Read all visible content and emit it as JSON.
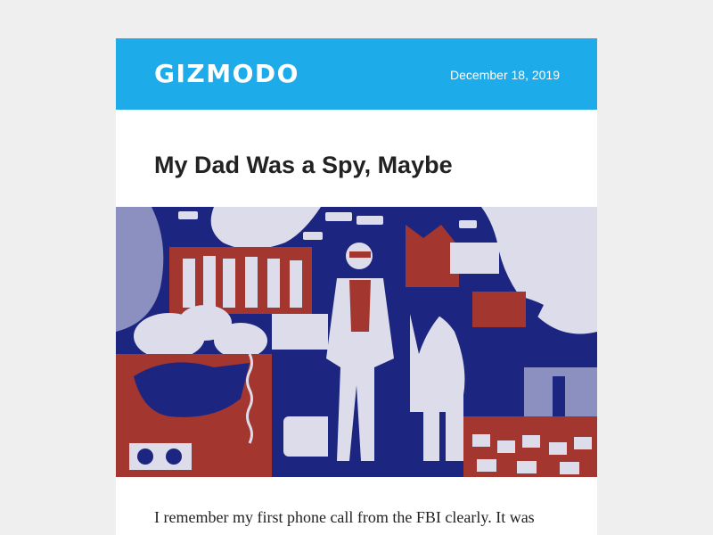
{
  "header": {
    "logo": "GIZMODO",
    "date": "December 18, 2019",
    "background": "#1dabe9"
  },
  "article": {
    "title": "My Dad Was a Spy, Maybe",
    "excerpt": "I remember my first phone call from the FBI clearly. It was"
  },
  "hero_palette": {
    "navy": "#1c2580",
    "red": "#a43630",
    "pale": "#dcdcea",
    "mid": "#8c90c0"
  }
}
